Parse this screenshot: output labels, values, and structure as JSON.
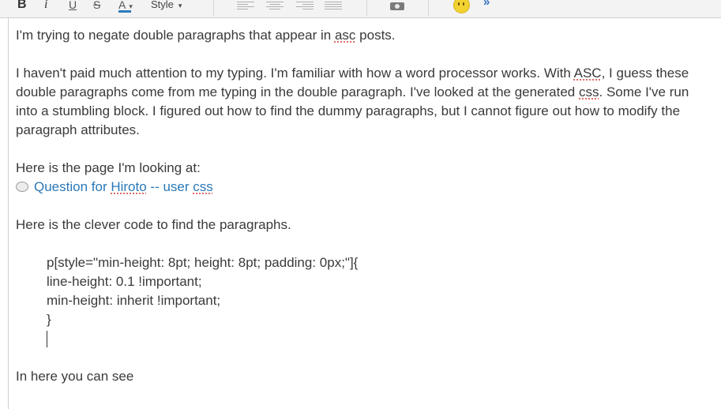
{
  "toolbar": {
    "bold_label": "B",
    "italic_label": "i",
    "underline_label": "U",
    "strike_label": "S",
    "color_label": "A",
    "caret": "▾",
    "style_label": "Style",
    "more_label": "»",
    "accent_color": "#2e6fc0"
  },
  "post": {
    "line1_a": "I'm trying to negate double paragraphs that appear in ",
    "line1_asc": "asc",
    "line1_b": " posts.",
    "para2_a": "I haven't paid much attention to my typing.  I'm familiar with how a word processor works.  With  ",
    "para2_asc": "ASC",
    "para2_b": ", I guess these double paragraphs come from me typing in the double paragraph.  I've looked at the generated ",
    "para2_css": "css",
    "para2_c": ".  Some I've run into a stumbling block.  I figured out how to find the dummy paragraphs, but I cannot figure out how to modify the paragraph attributes.",
    "page_intro": "Here is the page I'm looking at:",
    "link_a": "Question for ",
    "link_hiroto": "Hiroto",
    "link_b": " -- user ",
    "link_css": "css",
    "code_intro": "Here is the clever code to find the paragraphs.",
    "code_lines": [
      "p[style=\"min-height: 8pt; height: 8pt; padding: 0px;\"]{",
      "line-height: 0.1 !important;",
      "min-height: inherit !important;",
      "}"
    ],
    "closing": "In here you can see"
  }
}
